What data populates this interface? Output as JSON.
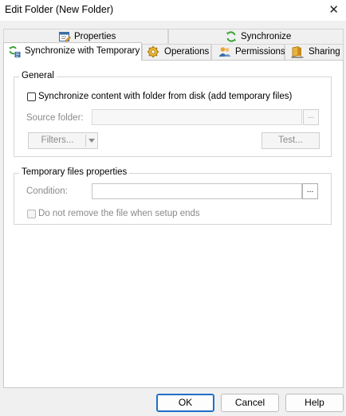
{
  "window": {
    "title": "Edit Folder (New Folder)"
  },
  "tabs": {
    "row1": [
      {
        "label": "Properties",
        "icon": "properties-icon"
      },
      {
        "label": "Synchronize",
        "icon": "synchronize-icon"
      }
    ],
    "row2": [
      {
        "label": "Synchronize with Temporary",
        "icon": "sync-temporary-icon",
        "active": true
      },
      {
        "label": "Operations",
        "icon": "gear-icon"
      },
      {
        "label": "Permissions",
        "icon": "users-icon"
      },
      {
        "label": "Sharing",
        "icon": "share-icon"
      }
    ]
  },
  "general": {
    "title": "General",
    "sync_checkbox_label": "Synchronize content with folder from disk (add temporary files)",
    "sync_checked": false,
    "source_folder_label": "Source folder:",
    "source_folder_value": "",
    "browse_label": "...",
    "filters_label": "Filters...",
    "test_label": "Test..."
  },
  "temp": {
    "title": "Temporary files properties",
    "condition_label": "Condition:",
    "condition_value": "",
    "condition_browse_label": "...",
    "keep_file_label": "Do not remove the file when setup ends",
    "keep_file_checked": false
  },
  "footer": {
    "ok_label": "OK",
    "cancel_label": "Cancel",
    "help_label": "Help"
  }
}
